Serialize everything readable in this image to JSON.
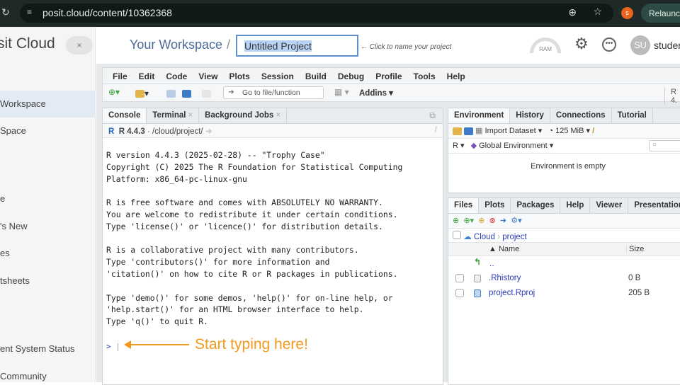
{
  "browser": {
    "url": "posit.cloud/content/10362368",
    "profile_initial": "s",
    "relaunch_label": "Relaunch"
  },
  "sidebar": {
    "logo": "sit Cloud",
    "items": [
      "Workspace",
      "Space",
      "e",
      "'s New",
      "es",
      "tsheets",
      "ent System Status",
      "Community"
    ]
  },
  "header": {
    "breadcrumb": "Your Workspace",
    "sep": "/",
    "project_name": "Untitled Project",
    "hint": "← Click to name your project",
    "ram_label": "RAM",
    "avatar_initials": "SU",
    "user": "studen"
  },
  "ide": {
    "menu": [
      "File",
      "Edit",
      "Code",
      "View",
      "Plots",
      "Session",
      "Build",
      "Debug",
      "Profile",
      "Tools",
      "Help"
    ],
    "toolbar": {
      "goto_placeholder": "Go to file/function",
      "addins": "Addins",
      "version": "R 4."
    },
    "console": {
      "tabs": [
        "Console",
        "Terminal",
        "Background Jobs"
      ],
      "path_version": "R 4.4.3",
      "path": "· /cloud/project/",
      "output": "R version 4.4.3 (2025-02-28) -- \"Trophy Case\"\nCopyright (C) 2025 The R Foundation for Statistical Computing\nPlatform: x86_64-pc-linux-gnu\n\nR is free software and comes with ABSOLUTELY NO WARRANTY.\nYou are welcome to redistribute it under certain conditions.\nType 'license()' or 'licence()' for distribution details.\n\nR is a collaborative project with many contributors.\nType 'contributors()' for more information and\n'citation()' on how to cite R or R packages in publications.\n\nType 'demo()' for some demos, 'help()' for on-line help, or\n'help.start()' for an HTML browser interface to help.\nType 'q()' to quit R.",
      "prompt": ">",
      "annotation": "Start typing here!"
    },
    "environment": {
      "tabs": [
        "Environment",
        "History",
        "Connections",
        "Tutorial"
      ],
      "import": "Import Dataset",
      "memory": "125 MiB",
      "lang": "R",
      "scope": "Global Environment",
      "empty": "Environment is empty"
    },
    "files": {
      "tabs": [
        "Files",
        "Plots",
        "Packages",
        "Help",
        "Viewer",
        "Presentation"
      ],
      "crumbs": [
        "Cloud",
        "project"
      ],
      "col_name": "Name",
      "col_size": "Size",
      "up": "..",
      "rows": [
        {
          "name": ".Rhistory",
          "size": "0 B"
        },
        {
          "name": "project.Rproj",
          "size": "205 B"
        }
      ]
    }
  },
  "colors": {
    "accent": "#f39a1e",
    "link": "#2a3bb5"
  }
}
